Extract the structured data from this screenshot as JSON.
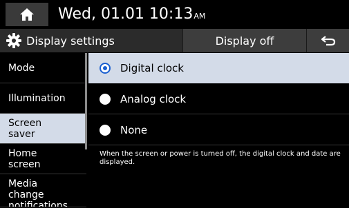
{
  "status": {
    "date_time": "Wed, 01.01  10:13",
    "ampm": "AM",
    "home_icon": "home-icon"
  },
  "header": {
    "title": "Display settings",
    "title_icon": "gear-icon",
    "display_off": "Display off",
    "back_icon": "back-icon"
  },
  "sidebar": {
    "items": [
      {
        "label": "Mode"
      },
      {
        "label": "Illumination"
      },
      {
        "label": "Screen saver"
      },
      {
        "label": "Home screen"
      },
      {
        "label": "Media change notifications"
      }
    ],
    "active_index": 2
  },
  "options": [
    {
      "label": "Digital clock",
      "selected": true
    },
    {
      "label": "Analog clock",
      "selected": false
    },
    {
      "label": "None",
      "selected": false
    }
  ],
  "description": "When the screen or power is turned off, the digital clock and date are displayed.",
  "colors": {
    "background": "#000000",
    "selected_row": "#d3dbe8",
    "radio_accent": "#1a5fd0",
    "header_bar": "#2b2b2b"
  }
}
